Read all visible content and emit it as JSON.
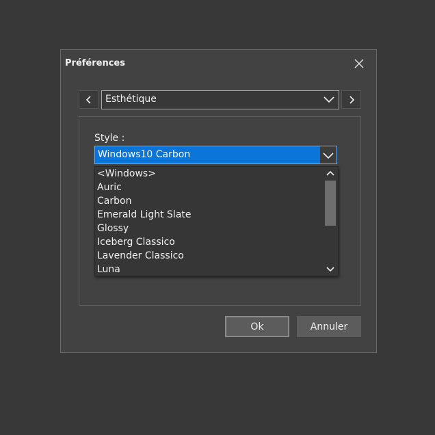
{
  "dialog": {
    "title": "Préférences"
  },
  "nav": {
    "page_selected": "Esthétique"
  },
  "style": {
    "label": "Style :",
    "selected": "Windows10 Carbon",
    "options": [
      "<Windows>",
      "Auric",
      "Carbon",
      "Emerald Light Slate",
      "Glossy",
      "Iceberg Classico",
      "Lavender Classico",
      "Luna"
    ]
  },
  "buttons": {
    "ok": "Ok",
    "cancel": "Annuler"
  },
  "colors": {
    "background": "#383838",
    "dialog": "#424242",
    "selection": "#0a74d8"
  },
  "icons": {
    "close": "close-icon",
    "prev": "chevron-left-icon",
    "next": "chevron-right-icon",
    "dropdown": "chevron-down-icon",
    "scroll_up": "chevron-up-icon",
    "scroll_down": "chevron-down-icon"
  }
}
